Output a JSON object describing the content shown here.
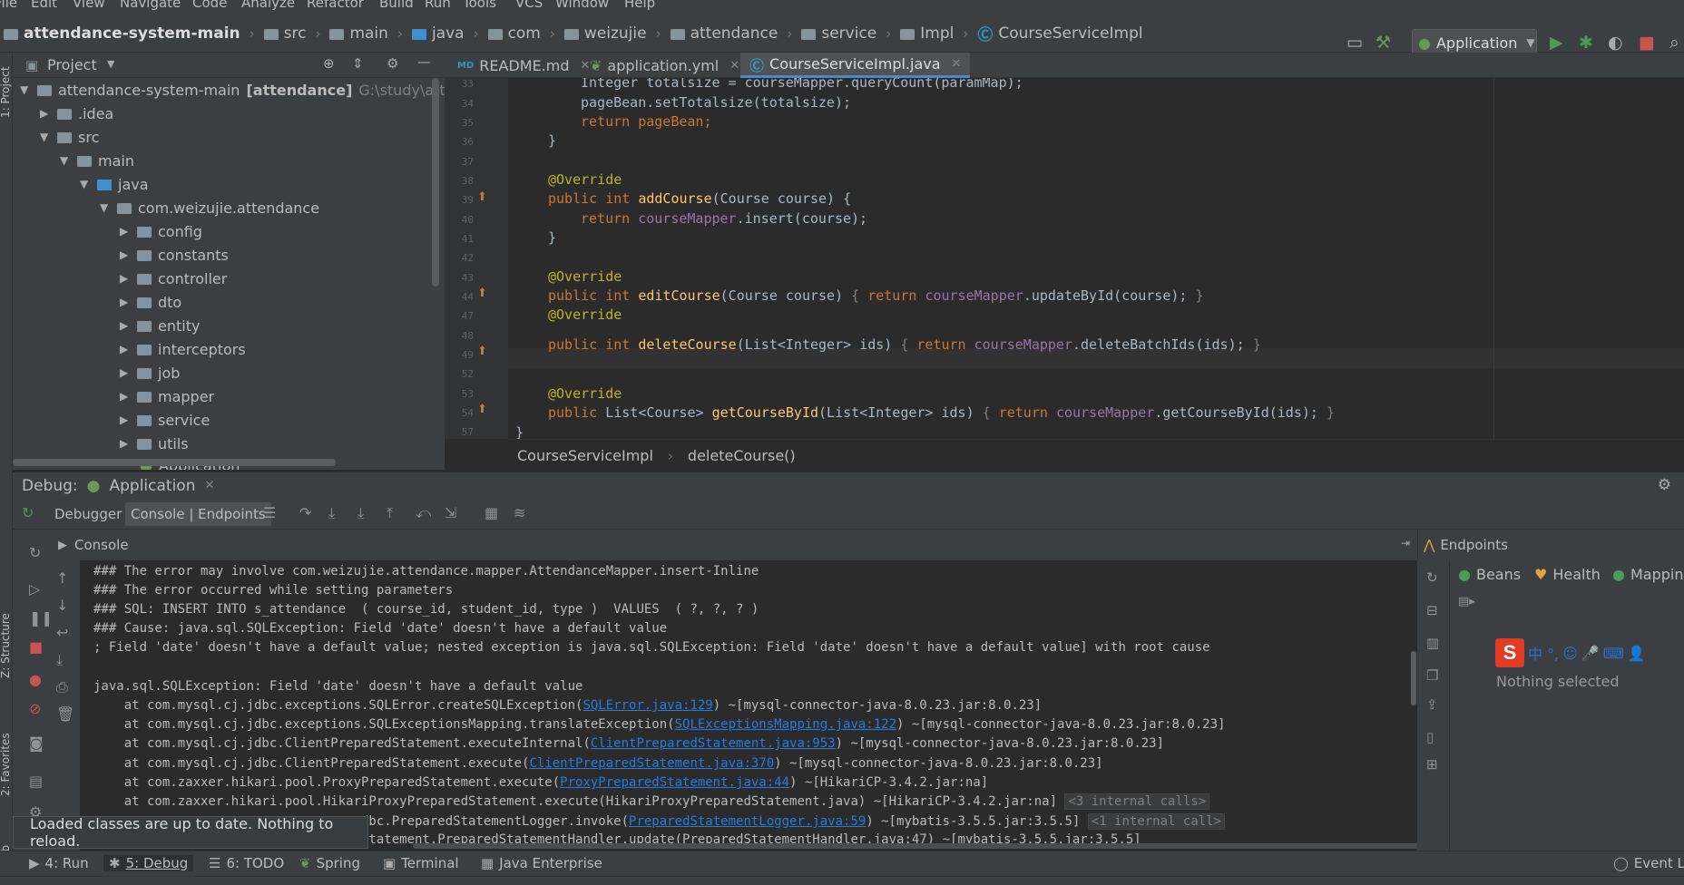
{
  "menubar": {
    "items": [
      "File",
      "Edit",
      "View",
      "Navigate",
      "Code",
      "Analyze",
      "Refactor",
      "Build",
      "Run",
      "Tools",
      "VCS",
      "Window",
      "Help"
    ]
  },
  "breadcrumb": {
    "project": "attendance-system-main",
    "parts": [
      "src",
      "main",
      "java",
      "com",
      "weizujie",
      "attendance",
      "service",
      "Impl"
    ],
    "file": "CourseServiceImpl"
  },
  "run_config": {
    "label": "Application"
  },
  "project_panel": {
    "title": "Project",
    "strip_label": "1: Project"
  },
  "tree": {
    "root": "attendance-system-main",
    "root_module": "[attendance]",
    "root_path": "G:\\study\\attendance",
    "idea": ".idea",
    "src": "src",
    "main": "main",
    "java": "java",
    "pkg": "com.weizujie.attendance",
    "pkgs": [
      "config",
      "constants",
      "controller",
      "dto",
      "entity",
      "interceptors",
      "job",
      "mapper",
      "service",
      "utils"
    ],
    "cut": "Application"
  },
  "editor_tabs": [
    {
      "label": "README.md",
      "icon": "MD"
    },
    {
      "label": "application.yml",
      "icon": "yml"
    },
    {
      "label": "CourseServiceImpl.java",
      "icon": "C"
    }
  ],
  "code": {
    "line_numbers": [
      "33",
      "34",
      "35",
      "36",
      "37",
      "38",
      "39",
      "40",
      "41",
      "42",
      "43",
      "44",
      "47",
      "48",
      "49",
      "52",
      "53",
      "54",
      "57"
    ],
    "l33": "Integer totalsize = courseMapper.queryCount(paramMap);",
    "l34": "pageBean.setTotalsize(totalsize);",
    "l35": "return pageBean;",
    "override": "@Override",
    "kw_public": "public",
    "kw_int": "int",
    "kw_return": "return",
    "addCourse": "addCourse",
    "addCourse_sig": "(Course course) {",
    "addCourse_body_obj": "courseMapper",
    ".insert": ".insert(course);",
    "editCourse": "editCourse",
    "editCourse_sig": "(Course course) ",
    "editCourse_body": "courseMapper",
    ".updateById": ".updateById(course); ",
    "deleteCourse": "deleteCourse",
    "deleteCourse_sig": "(List<Integer> ids) ",
    "deleteCourse_body": "courseMapper",
    ".deleteBatchIds": ".deleteBatchIds(ids); ",
    "getType": "List<Course> ",
    "getCourseById": "getCourseById",
    "getCourseById_sig": "(List<Integer> ids) ",
    "getCourseById_body": "courseMapper",
    ".getCourseById": ".getCourseById(ids); ",
    "brace_close": "}",
    "brace_open": "{"
  },
  "editor_breadcrumb": {
    "class": "CourseServiceImpl",
    "method": "deleteCourse()"
  },
  "debug": {
    "title": "Debug:",
    "config": "Application",
    "tab_debugger": "Debugger",
    "tab_console": "Console | Endpoints"
  },
  "console": {
    "title": "Console",
    "lines": [
      "### The error may involve com.weizujie.attendance.mapper.AttendanceMapper.insert-Inline",
      "### The error occurred while setting parameters",
      "### SQL: INSERT INTO s_attendance  ( course_id, student_id, type )  VALUES  ( ?, ?, ? )",
      "### Cause: java.sql.SQLException: Field 'date' doesn't have a default value",
      "; Field 'date' doesn't have a default value; nested exception is java.sql.SQLException: Field 'date' doesn't have a default value] with root cause",
      "java.sql.SQLException: Field 'date' doesn't have a default value"
    ],
    "stack": [
      {
        "pre": "    at com.mysql.cj.jdbc.exceptions.SQLError.createSQLException(",
        "link": "SQLError.java:129",
        "post": ") ~[mysql-connector-java-8.0.23.jar:8.0.23]",
        "chip": ""
      },
      {
        "pre": "    at com.mysql.cj.jdbc.exceptions.SQLExceptionsMapping.translateException(",
        "link": "SQLExceptionsMapping.java:122",
        "post": ") ~[mysql-connector-java-8.0.23.jar:8.0.23]",
        "chip": ""
      },
      {
        "pre": "    at com.mysql.cj.jdbc.ClientPreparedStatement.executeInternal(",
        "link": "ClientPreparedStatement.java:953",
        "post": ") ~[mysql-connector-java-8.0.23.jar:8.0.23]",
        "chip": ""
      },
      {
        "pre": "    at com.mysql.cj.jdbc.ClientPreparedStatement.execute(",
        "link": "ClientPreparedStatement.java:370",
        "post": ") ~[mysql-connector-java-8.0.23.jar:8.0.23]",
        "chip": ""
      },
      {
        "pre": "    at com.zaxxer.hikari.pool.ProxyPreparedStatement.execute(",
        "link": "ProxyPreparedStatement.java:44",
        "post": ") ~[HikariCP-3.4.2.jar:na]",
        "chip": ""
      },
      {
        "pre": "    at com.zaxxer.hikari.pool.HikariProxyPreparedStatement.execute(HikariProxyPreparedStatement.java) ~[HikariCP-3.4.2.jar:na] ",
        "link": "",
        "post": "",
        "chip": "<3 internal calls>"
      },
      {
        "pre": "                                   dbc.PreparedStatementLogger.invoke(",
        "link": "PreparedStatementLogger.java:59",
        "post": ") ~[mybatis-3.5.5.jar:3.5.5] ",
        "chip": "<1 internal call>"
      },
      {
        "pre": "                                   statement.PreparedStatementHandler.update(PreparedStatementHandler.java:47) ~[mybatis-3.5.5.jar:3.5.5]",
        "link": "",
        "post": "",
        "chip": ""
      }
    ]
  },
  "endpoints": {
    "title": "Endpoints",
    "tabs": [
      "Beans",
      "Health",
      "Mappings"
    ],
    "empty": "Nothing selected"
  },
  "toast": "Loaded classes are up to date. Nothing to reload.",
  "bottom_tabs": [
    "4: Run",
    "5: Debug",
    "6: TODO",
    "Spring",
    "Terminal",
    "Java Enterprise"
  ],
  "event_log": "Event Log",
  "side_labels": {
    "structure": "Z: Structure",
    "favorites": "2: Favorites",
    "web": "Web"
  },
  "ime": {
    "logo": "S",
    "chars": "中 °,"
  }
}
